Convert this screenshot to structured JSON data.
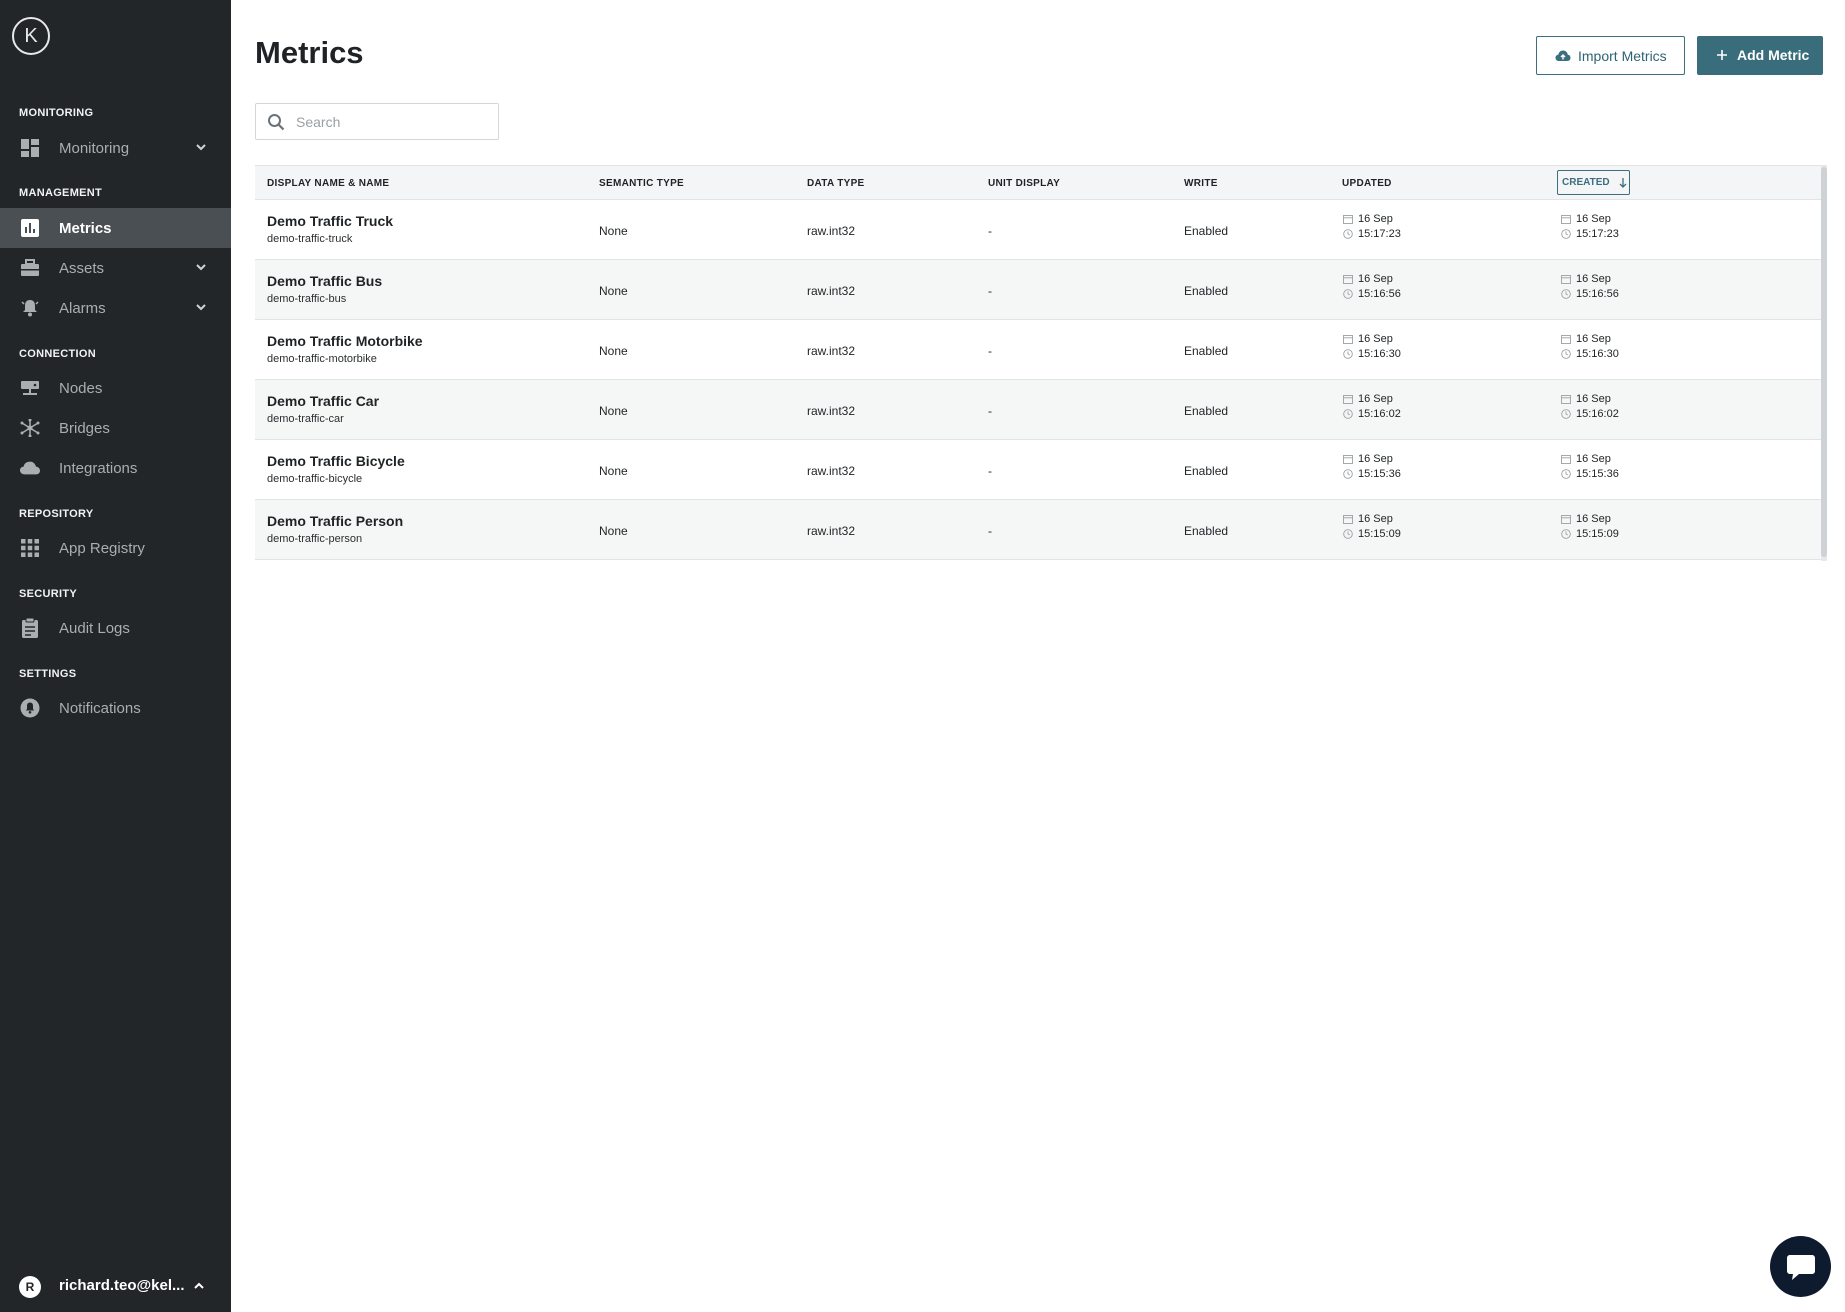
{
  "app": {
    "logo_letter": "K"
  },
  "sidebar": {
    "sections": {
      "monitoring": "MONITORING",
      "management": "MANAGEMENT",
      "connection": "CONNECTION",
      "repository": "REPOSITORY",
      "security": "SECURITY",
      "settings": "SETTINGS"
    },
    "items": {
      "monitoring": "Monitoring",
      "metrics": "Metrics",
      "assets": "Assets",
      "alarms": "Alarms",
      "nodes": "Nodes",
      "bridges": "Bridges",
      "integrations": "Integrations",
      "app_registry": "App Registry",
      "audit_logs": "Audit Logs",
      "notifications": "Notifications"
    },
    "active_item": "metrics",
    "user": {
      "initial": "R",
      "name": "richard.teo@kel..."
    }
  },
  "header": {
    "title": "Metrics",
    "import_label": "Import Metrics",
    "add_label": "Add Metric"
  },
  "search": {
    "placeholder": "Search",
    "value": ""
  },
  "table": {
    "columns": {
      "name": "DISPLAY NAME & NAME",
      "semantic": "SEMANTIC TYPE",
      "data_type": "DATA TYPE",
      "unit": "UNIT DISPLAY",
      "write": "WRITE",
      "updated": "UPDATED",
      "created": "CREATED"
    },
    "sort": {
      "column": "created",
      "direction": "descending"
    },
    "rows": [
      {
        "display_name": "Demo Traffic Truck",
        "name": "demo-traffic-truck",
        "semantic": "None",
        "data_type": "raw.int32",
        "unit": "-",
        "write": "Enabled",
        "updated_date": "16 Sep",
        "updated_time": "15:17:23",
        "created_date": "16 Sep",
        "created_time": "15:17:23"
      },
      {
        "display_name": "Demo Traffic Bus",
        "name": "demo-traffic-bus",
        "semantic": "None",
        "data_type": "raw.int32",
        "unit": "-",
        "write": "Enabled",
        "updated_date": "16 Sep",
        "updated_time": "15:16:56",
        "created_date": "16 Sep",
        "created_time": "15:16:56"
      },
      {
        "display_name": "Demo Traffic Motorbike",
        "name": "demo-traffic-motorbike",
        "semantic": "None",
        "data_type": "raw.int32",
        "unit": "-",
        "write": "Enabled",
        "updated_date": "16 Sep",
        "updated_time": "15:16:30",
        "created_date": "16 Sep",
        "created_time": "15:16:30"
      },
      {
        "display_name": "Demo Traffic Car",
        "name": "demo-traffic-car",
        "semantic": "None",
        "data_type": "raw.int32",
        "unit": "-",
        "write": "Enabled",
        "updated_date": "16 Sep",
        "updated_time": "15:16:02",
        "created_date": "16 Sep",
        "created_time": "15:16:02"
      },
      {
        "display_name": "Demo Traffic Bicycle",
        "name": "demo-traffic-bicycle",
        "semantic": "None",
        "data_type": "raw.int32",
        "unit": "-",
        "write": "Enabled",
        "updated_date": "16 Sep",
        "updated_time": "15:15:36",
        "created_date": "16 Sep",
        "created_time": "15:15:36"
      },
      {
        "display_name": "Demo Traffic Person",
        "name": "demo-traffic-person",
        "semantic": "None",
        "data_type": "raw.int32",
        "unit": "-",
        "write": "Enabled",
        "updated_date": "16 Sep",
        "updated_time": "15:15:09",
        "created_date": "16 Sep",
        "created_time": "15:15:09"
      }
    ]
  },
  "icons": {
    "logo": "logo-icon",
    "monitoring": "dashboard-icon",
    "metrics": "bar-chart-icon",
    "assets": "briefcase-icon",
    "alarms": "bell-icon",
    "nodes": "node-icon",
    "bridges": "bridge-icon",
    "integrations": "cloud-icon",
    "app_registry": "grid-icon",
    "audit_logs": "clipboard-icon",
    "notifications": "notification-icon",
    "chat": "chat-icon"
  },
  "colors": {
    "sidebar_bg": "#222628",
    "sidebar_active": "#4a4f53",
    "accent": "#3a6d7b",
    "chat_bg": "#0e1b2e"
  }
}
